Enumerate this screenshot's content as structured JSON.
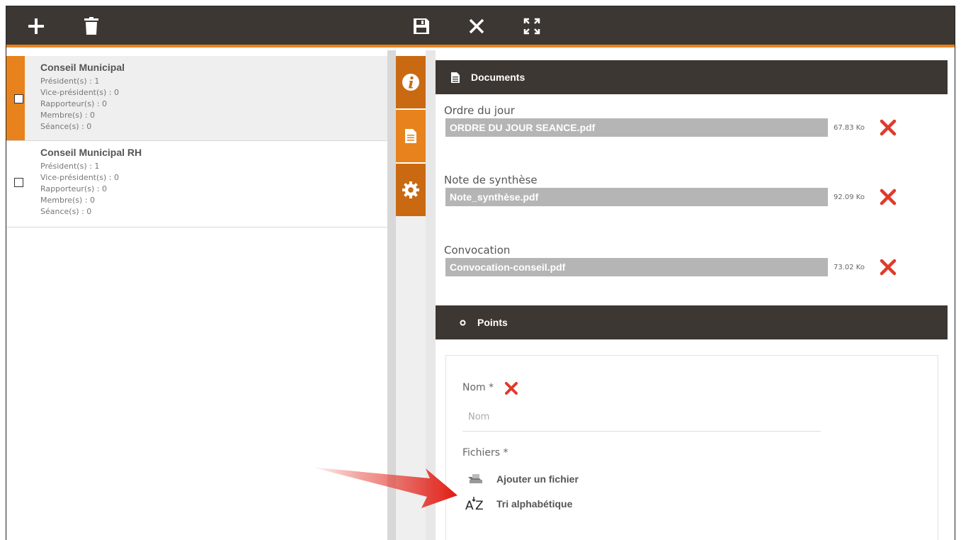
{
  "toolbar": {
    "add_icon": "plus-icon",
    "delete_icon": "trash-icon",
    "save_icon": "floppy-disk-icon",
    "close_icon": "close-icon",
    "fullscreen_icon": "expand-icon",
    "background": "#3d3733",
    "accent": "#e8821c"
  },
  "list": {
    "items": [
      {
        "title": "Conseil Municipal",
        "lines": [
          "Président(s) : 1",
          "Vice-président(s) : 0",
          "Rapporteur(s) : 0",
          "Membre(s) : 0",
          "Séance(s) : 0"
        ],
        "selected": true
      },
      {
        "title": "Conseil Municipal RH",
        "lines": [
          "Président(s) : 1",
          "Vice-président(s) : 0",
          "Rapporteur(s) : 0",
          "Membre(s) : 0",
          "Séance(s) : 0"
        ],
        "selected": false
      }
    ]
  },
  "sidetabs": [
    {
      "icon": "info-icon"
    },
    {
      "icon": "document-icon",
      "active": true
    },
    {
      "icon": "gear-icon"
    }
  ],
  "documents": {
    "header": "Documents",
    "items": [
      {
        "label": "Ordre du jour",
        "file": "ORDRE DU JOUR SEANCE.pdf",
        "size": "67.83 Ko"
      },
      {
        "label": "Note de synthèse",
        "file": "Note_synthèse.pdf",
        "size": "92.09 Ko"
      },
      {
        "label": "Convocation",
        "file": "Convocation-conseil.pdf",
        "size": "73.02 Ko"
      }
    ]
  },
  "points": {
    "header": "Points",
    "nom_label": "Nom *",
    "nom_placeholder": "Nom",
    "fichiers_label": "Fichiers *",
    "add_file": "Ajouter un fichier",
    "sort_alpha": "Tri alphabétique"
  },
  "colors": {
    "delete_red": "#e03a2a",
    "file_bar": "#b5b5b5"
  }
}
